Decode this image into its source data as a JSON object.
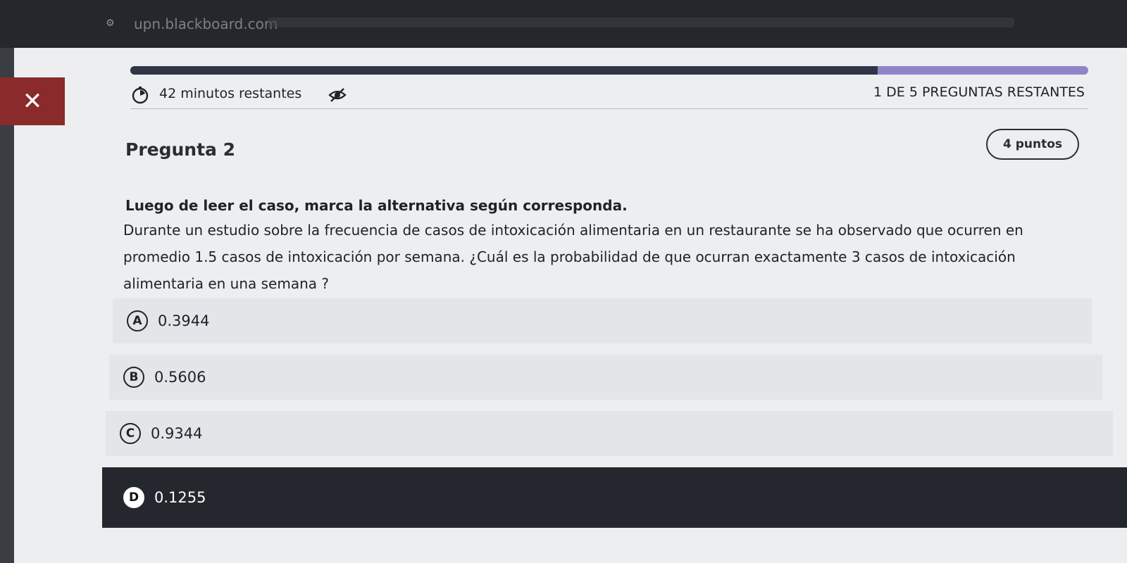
{
  "browser": {
    "url": "upn.blackboard.com"
  },
  "quiz": {
    "close_icon": "close-icon",
    "timer_text": "42 minutos restantes",
    "remaining_text": "1 DE 5 PREGUNTAS RESTANTES",
    "progress": 0.78
  },
  "question": {
    "title": "Pregunta 2",
    "points": "4 puntos",
    "instruction": "Luego de leer el caso, marca la alternativa según corresponda.",
    "text": "Durante un estudio sobre la frecuencia de casos de intoxicación alimentaria en un restaurante se ha observado que ocurren en promedio 1.5 casos de intoxicación por semana. ¿Cuál es la probabilidad de que ocurran exactamente 3 casos de intoxicación alimentaria en una semana ?",
    "options": [
      {
        "letter": "A",
        "value": "0.3944"
      },
      {
        "letter": "B",
        "value": "0.5606"
      },
      {
        "letter": "C",
        "value": "0.9344"
      },
      {
        "letter": "D",
        "value": "0.1255"
      }
    ],
    "selected": "D"
  },
  "colors": {
    "close_button": "#8a2a2a",
    "progress_fill": "#2f3546",
    "progress_track": "#8f84c8",
    "selected_option": "#24272d"
  }
}
